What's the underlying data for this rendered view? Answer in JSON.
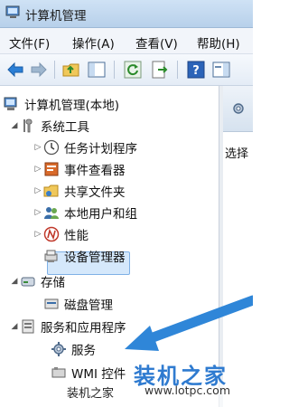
{
  "window": {
    "title": "计算机管理"
  },
  "menu": [
    "文件(F)",
    "操作(A)",
    "查看(V)",
    "帮助(H)"
  ],
  "toolbar": [
    "back-arrow-icon",
    "forward-arrow-icon",
    "up-folder-icon",
    "show-hide-tree-icon",
    "refresh-icon",
    "export-icon",
    "help-icon",
    "properties-icon"
  ],
  "tree": {
    "root": "计算机管理(本地)",
    "system_tools": "系统工具",
    "task_scheduler": "任务计划程序",
    "event_viewer": "事件查看器",
    "shared_folders": "共享文件夹",
    "local_users": "本地用户和组",
    "performance": "性能",
    "device_manager": "设备管理器",
    "storage": "存储",
    "disk_management": "磁盘管理",
    "services_apps": "服务和应用程序",
    "services": "服务",
    "wmi": "WMI 控件"
  },
  "right_pane": {
    "label": "选择"
  },
  "watermark": {
    "big": "装机之家",
    "small": "装机之家",
    "url": "www.lotpc.com"
  },
  "colors": {
    "accent": "#2f7bd0",
    "selection": "#d5e8fb"
  }
}
